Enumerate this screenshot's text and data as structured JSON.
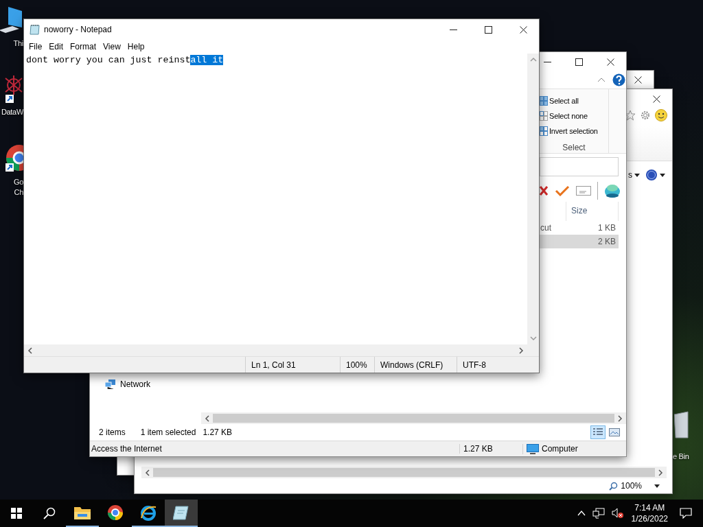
{
  "desktop_icons": [
    {
      "kind": "pc",
      "label": [
        "Thi"
      ]
    },
    {
      "kind": "app",
      "label": [
        "DataW"
      ]
    },
    {
      "kind": "browser",
      "label": [
        "Go",
        "Ch"
      ]
    },
    {
      "kind": "bin",
      "label": [
        "e Bin"
      ]
    }
  ],
  "back_window": {
    "toolbar_text": "s",
    "zoom": "100%"
  },
  "explorer": {
    "ribbon_items": [
      "Select all",
      "Select none",
      "Invert selection"
    ],
    "ribbon_group": "Select",
    "columns": [
      "Size"
    ],
    "rows": [
      {
        "name": "cut",
        "size": "1 KB",
        "selected": false
      },
      {
        "size": "2 KB",
        "selected": true
      }
    ],
    "nav": [
      "Network"
    ],
    "status": [
      "2 items",
      "1 item selected",
      "1.27 KB"
    ],
    "views": [
      {
        "kind": "details",
        "selected": true
      },
      {
        "kind": "preview",
        "selected": false
      }
    ],
    "status_bar": {
      "description": "Access the Internet",
      "size": "1.27 KB",
      "zone": "Computer"
    }
  },
  "notepad": {
    "title": "noworry - Notepad",
    "menu": [
      "File",
      "Edit",
      "Format",
      "View",
      "Help"
    ],
    "text": "dont worry you can just reinst",
    "selected_text": "all it",
    "status": [
      "Ln 1, Col 31",
      "100%",
      "Windows (CRLF)",
      "UTF-8"
    ]
  },
  "taskbar": {
    "apps": [
      {
        "kind": "explorer",
        "running": true,
        "selected": false
      },
      {
        "kind": "chrome",
        "running": false,
        "selected": false
      },
      {
        "kind": "ie",
        "running": true,
        "selected": false
      },
      {
        "kind": "notepad",
        "running": true,
        "selected": true
      }
    ],
    "time": "7:14 AM",
    "date": "1/26/2022"
  }
}
